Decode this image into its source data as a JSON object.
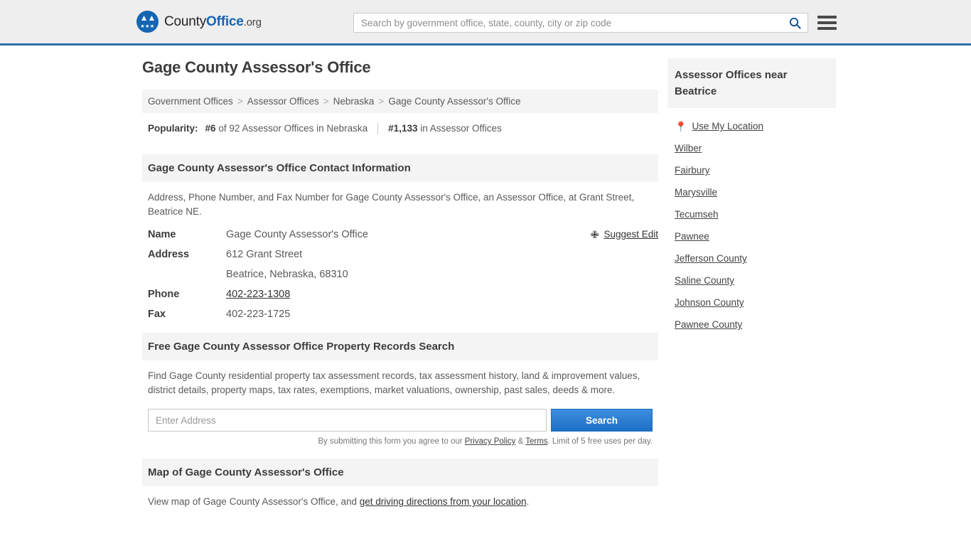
{
  "header": {
    "brand_part1": "County",
    "brand_part2": "Office",
    "brand_tld": ".org",
    "search_placeholder": "Search by government office, state, county, city or zip code",
    "search_value": "",
    "search_icon": "search-icon",
    "menu_icon": "hamburger-menu-icon"
  },
  "page": {
    "title": "Gage County Assessor's Office"
  },
  "breadcrumb": {
    "separator": ">",
    "items": [
      {
        "label": "Government Offices",
        "link": true
      },
      {
        "label": "Assessor Offices",
        "link": true
      },
      {
        "label": "Nebraska",
        "link": true
      },
      {
        "label": "Gage County Assessor's Office",
        "link": false
      }
    ]
  },
  "popularity": {
    "label": "Popularity:",
    "rank_state": "#6",
    "rank_state_text": "of 92 Assessor Offices in Nebraska",
    "rank_national": "#1,133",
    "rank_national_text": "in Assessor Offices"
  },
  "contact": {
    "heading": "Gage County Assessor's Office Contact Information",
    "description": "Address, Phone Number, and Fax Number for Gage County Assessor's Office, an Assessor Office, at Grant Street, Beatrice NE.",
    "suggest_edit": "Suggest Edit",
    "suggest_edit_icon": "edit-pencil-icon",
    "rows": [
      {
        "key": "Name",
        "value": "Gage County Assessor's Office",
        "link": false
      },
      {
        "key": "Address",
        "value": "612 Grant Street",
        "link": false
      },
      {
        "key": "",
        "value": "Beatrice, Nebraska, 68310",
        "link": false
      },
      {
        "key": "Phone",
        "value": "402-223-1308",
        "link": true
      },
      {
        "key": "Fax",
        "value": "402-223-1725",
        "link": false
      }
    ]
  },
  "records_search": {
    "heading": "Free Gage County Assessor Office Property Records Search",
    "description": "Find Gage County residential property tax assessment records, tax assessment history, land & improvement values, district details, property maps, tax rates, exemptions, market valuations, ownership, past sales, deeds & more.",
    "input_placeholder": "Enter Address",
    "input_value": "",
    "button_label": "Search",
    "note_prefix": "By submitting this form you agree to our ",
    "note_privacy": "Privacy Policy",
    "note_amp": " & ",
    "note_terms": "Terms",
    "note_suffix": ". Limit of 5 free uses per day."
  },
  "map_section": {
    "heading": "Map of Gage County Assessor's Office",
    "text_prefix": "View map of Gage County Assessor's Office, and ",
    "link_label": "get driving directions from your location",
    "text_suffix": "."
  },
  "sidebar": {
    "heading": "Assessor Offices near Beatrice",
    "use_my_location": "Use My Location",
    "location_icon": "map-pin-icon",
    "items": [
      {
        "label": "Wilber"
      },
      {
        "label": "Fairbury"
      },
      {
        "label": "Marysville"
      },
      {
        "label": "Tecumseh"
      },
      {
        "label": "Pawnee"
      },
      {
        "label": "Jefferson County"
      },
      {
        "label": "Saline County"
      },
      {
        "label": "Johnson County"
      },
      {
        "label": "Pawnee County"
      }
    ]
  },
  "colors": {
    "brand_blue": "#1565b3",
    "header_border": "#3071a9",
    "header_bg": "#eeeeee",
    "section_bg": "#f4f4f4",
    "button_blue": "#1f6fc4"
  }
}
